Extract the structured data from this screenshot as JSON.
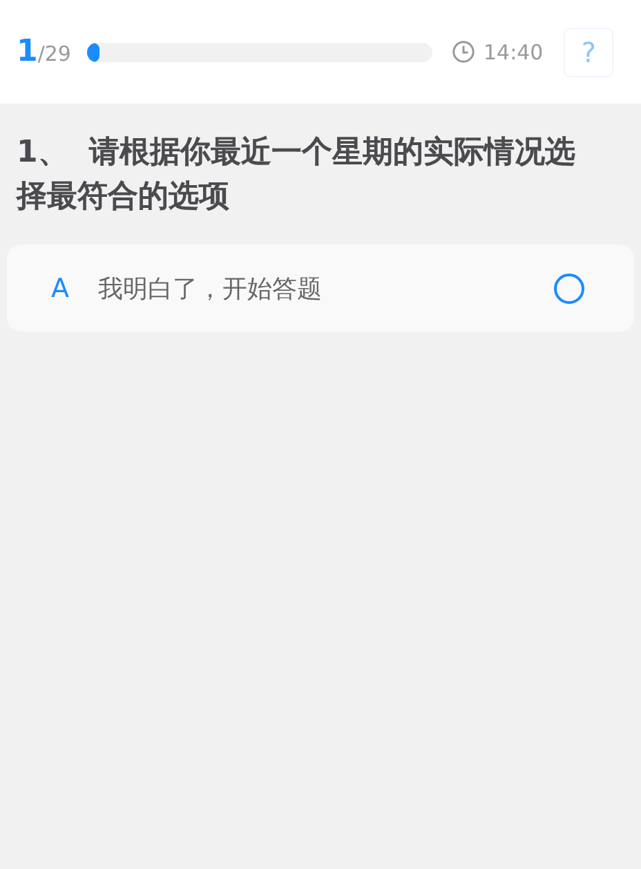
{
  "header": {
    "current": "1",
    "total": "/29",
    "progress": {
      "level": 0.034
    },
    "time": "14:40",
    "help": "?"
  },
  "question": {
    "number": "1、",
    "text": "请根据你最近一个星期的实际情况选择最符合的选项"
  },
  "options": [
    {
      "letter": "A",
      "text": "我明白了，开始答题",
      "selected": false
    }
  ]
}
